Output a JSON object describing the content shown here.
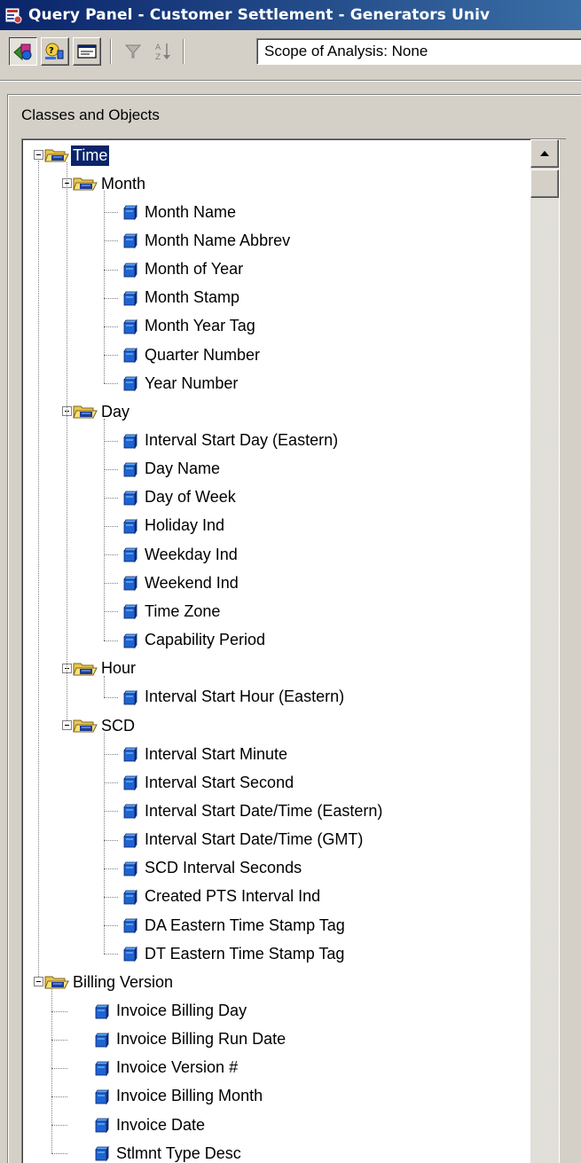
{
  "window": {
    "title": "Query Panel - Customer Settlement - Generators Univ"
  },
  "toolbar": {
    "scope_label": "Scope of Analysis: None",
    "buttons": [
      {
        "name": "classes-objects-button",
        "icon": "classes-objects-icon",
        "state": "pressed"
      },
      {
        "name": "predefined-conditions-button",
        "icon": "predefined-conditions-icon",
        "state": "raised"
      },
      {
        "name": "view-button",
        "icon": "window-icon",
        "state": "raised"
      },
      {
        "name": "filter-button",
        "icon": "funnel-icon",
        "state": "flat-disabled"
      },
      {
        "name": "sort-button",
        "icon": "sort-az-icon",
        "state": "flat-disabled"
      }
    ]
  },
  "panel": {
    "label": "Classes and Objects"
  },
  "tree": {
    "root": {
      "label": "Time",
      "selected": true,
      "children": [
        {
          "label": "Month",
          "objects": [
            "Month Name",
            "Month Name Abbrev",
            "Month of Year",
            "Month Stamp",
            "Month Year Tag",
            "Quarter Number",
            "Year Number"
          ]
        },
        {
          "label": "Day",
          "objects": [
            "Interval Start Day (Eastern)",
            "Day Name",
            "Day of Week",
            "Holiday Ind",
            "Weekday Ind",
            "Weekend Ind",
            "Time Zone",
            "Capability Period"
          ]
        },
        {
          "label": "Hour",
          "objects": [
            "Interval Start Hour (Eastern)"
          ]
        },
        {
          "label": "SCD",
          "objects": [
            "Interval Start Minute",
            "Interval Start Second",
            "Interval Start Date/Time (Eastern)",
            "Interval Start Date/Time (GMT)",
            "SCD Interval Seconds",
            "Created PTS Interval Ind",
            "DA Eastern Time Stamp Tag",
            "DT Eastern Time Stamp Tag"
          ]
        }
      ]
    },
    "second_root": {
      "label": "Billing Version",
      "objects": [
        "Invoice Billing Day",
        "Invoice Billing Run Date",
        "Invoice Version #",
        "Invoice Billing Month",
        "Invoice Date",
        "Stlmnt Type Desc"
      ]
    }
  },
  "colors": {
    "title_bar_start": "#0a246a",
    "title_bar_end": "#3a6ea5",
    "selection": "#0a246a",
    "folder": "#e8c84a",
    "object_cube": "#1e64d2"
  }
}
